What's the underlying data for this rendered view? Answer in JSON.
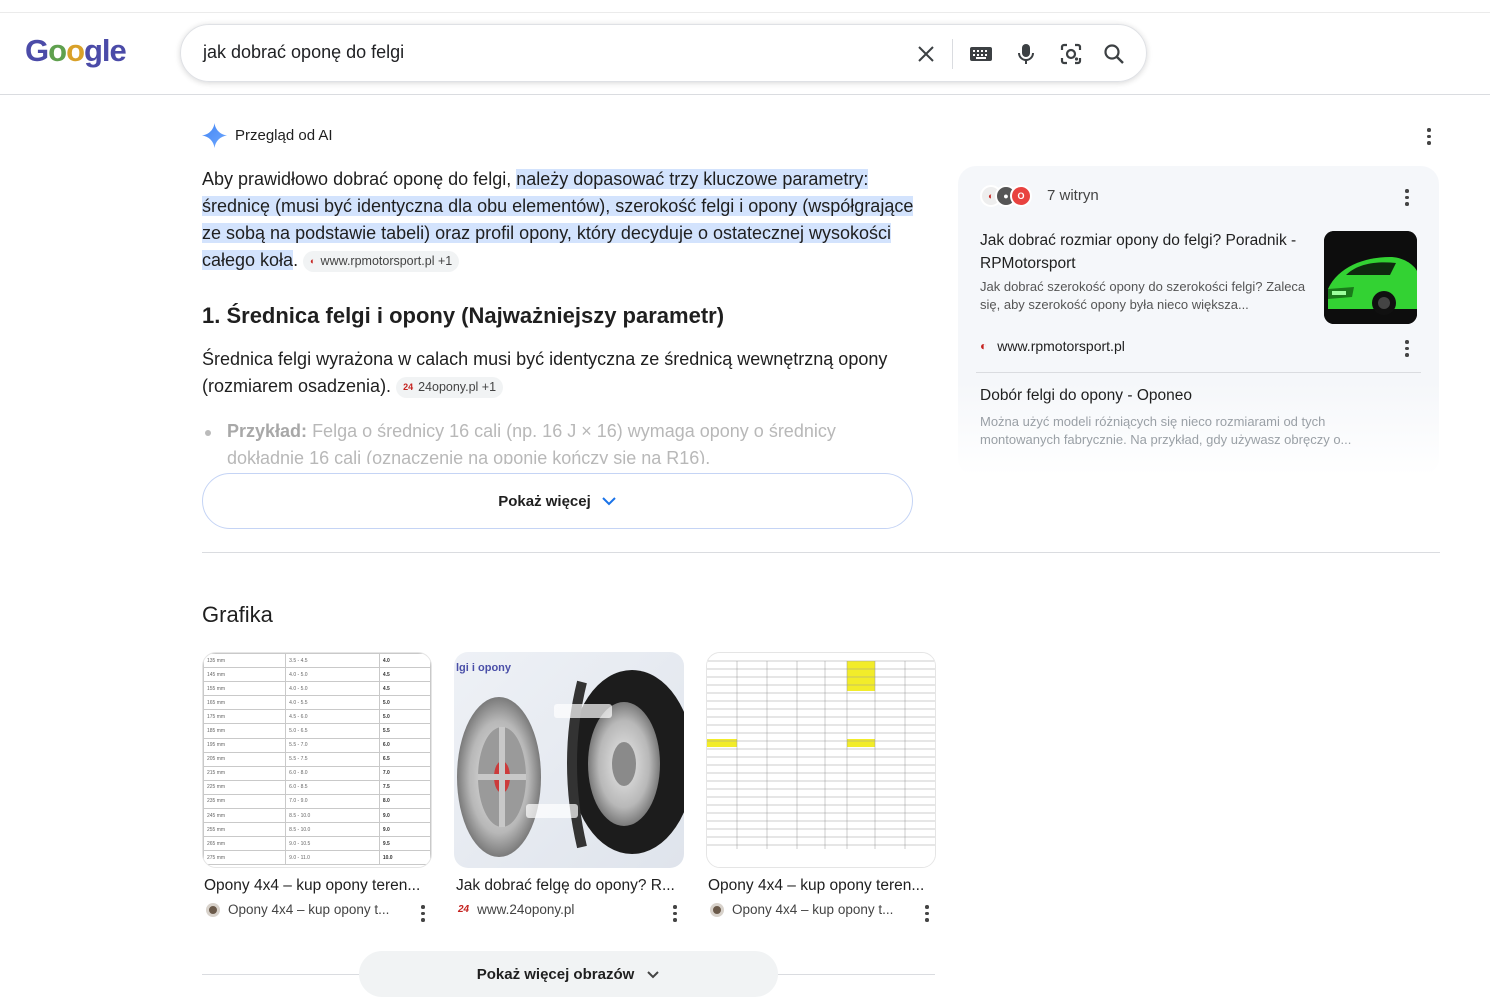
{
  "header": {
    "logo": "Google",
    "query": "jak dobrać oponę do felgi",
    "icons": [
      "close-icon",
      "keyboard-icon",
      "microphone-icon",
      "lens-icon",
      "search-icon"
    ]
  },
  "ai_overview": {
    "title": "Przegląd od AI",
    "intro_plain": "Aby prawidłowo dobrać oponę do felgi, ",
    "intro_highlight": "należy dopasować trzy kluczowe parametry: średnicę (musi być identyczna dla obu elementów), szerokość felgi i opony (współgrające ze sobą na podstawie tabeli) oraz profil opony, który decyduje o ostatecznej wysokości całego koła",
    "intro_end": ".",
    "intro_chip": "www.rpmotorsport.pl +1",
    "section_heading": "1. Średnica felgi i opony (Najważniejszy parametr)",
    "section_text": "Średnica felgi wyrażona w calach musi być identyczna ze średnicą wewnętrzną opony (rozmiarem osadzenia).",
    "section_chip_fav": "24",
    "section_chip": "24opony.pl +1",
    "bullet_label": "Przykład:",
    "bullet_text": "Felga o średnicy 16 cali (np. 16 J × 16) wymaga opony o średnicy dokładnie 16 cali (oznaczenie na oponie kończy się na R16).",
    "show_more": "Pokaż więcej"
  },
  "sources_panel": {
    "count": "7 witryn",
    "items": [
      {
        "title": "Jak dobrać rozmiar opony do felgi? Poradnik - RPMotorsport",
        "snippet": "Jak dobrać szerokość opony do szerokości felgi? Zaleca się, aby szerokość opony była nieco większa...",
        "site": "www.rpmotorsport.pl"
      },
      {
        "title": "Dobór felgi do opony - Oponeo",
        "snippet": "Można użyć modeli różniących się nieco rozmiarami od tych montowanych fabrycznie. Na przykład, gdy używasz obręczy o..."
      }
    ]
  },
  "images": {
    "heading": "Grafika",
    "items": [
      {
        "caption": "Opony 4x4 – kup opony teren...",
        "source": "Opony 4x4 – kup opony t..."
      },
      {
        "caption": "Jak dobrać felgę do opony? R...",
        "source_fav": "24",
        "source": "www.24opony.pl",
        "overlay": "lgi i opony"
      },
      {
        "caption": "Opony 4x4 – kup opony teren...",
        "source": "Opony 4x4 – kup opony t..."
      }
    ],
    "show_more": "Pokaż więcej obrazów",
    "table1": [
      [
        "135 mm",
        "3.5 - 4.5",
        "4.0"
      ],
      [
        "145 mm",
        "4.0 - 5.0",
        "4.5"
      ],
      [
        "155 mm",
        "4.0 - 5.0",
        "4.5"
      ],
      [
        "165 mm",
        "4.0 - 5.5",
        "5.0"
      ],
      [
        "175 mm",
        "4.5 - 6.0",
        "5.0"
      ],
      [
        "185 mm",
        "5.0 - 6.5",
        "5.5"
      ],
      [
        "195 mm",
        "5.5 - 7.0",
        "6.0"
      ],
      [
        "205 mm",
        "5.5 - 7.5",
        "6.5"
      ],
      [
        "215 mm",
        "6.0 - 8.0",
        "7.0"
      ],
      [
        "225 mm",
        "6.0 - 8.5",
        "7.5"
      ],
      [
        "235 mm",
        "7.0 - 9.0",
        "8.0"
      ],
      [
        "245 mm",
        "8.5 - 10.0",
        "9.0"
      ],
      [
        "255 mm",
        "8.5 - 10.0",
        "9.0"
      ],
      [
        "265 mm",
        "9.0 - 10.5",
        "9.5"
      ],
      [
        "275 mm",
        "9.0 - 11.0",
        "10.0"
      ]
    ]
  },
  "colors": {
    "highlight": "#d3e3fd",
    "accent": "#1a73e8"
  }
}
